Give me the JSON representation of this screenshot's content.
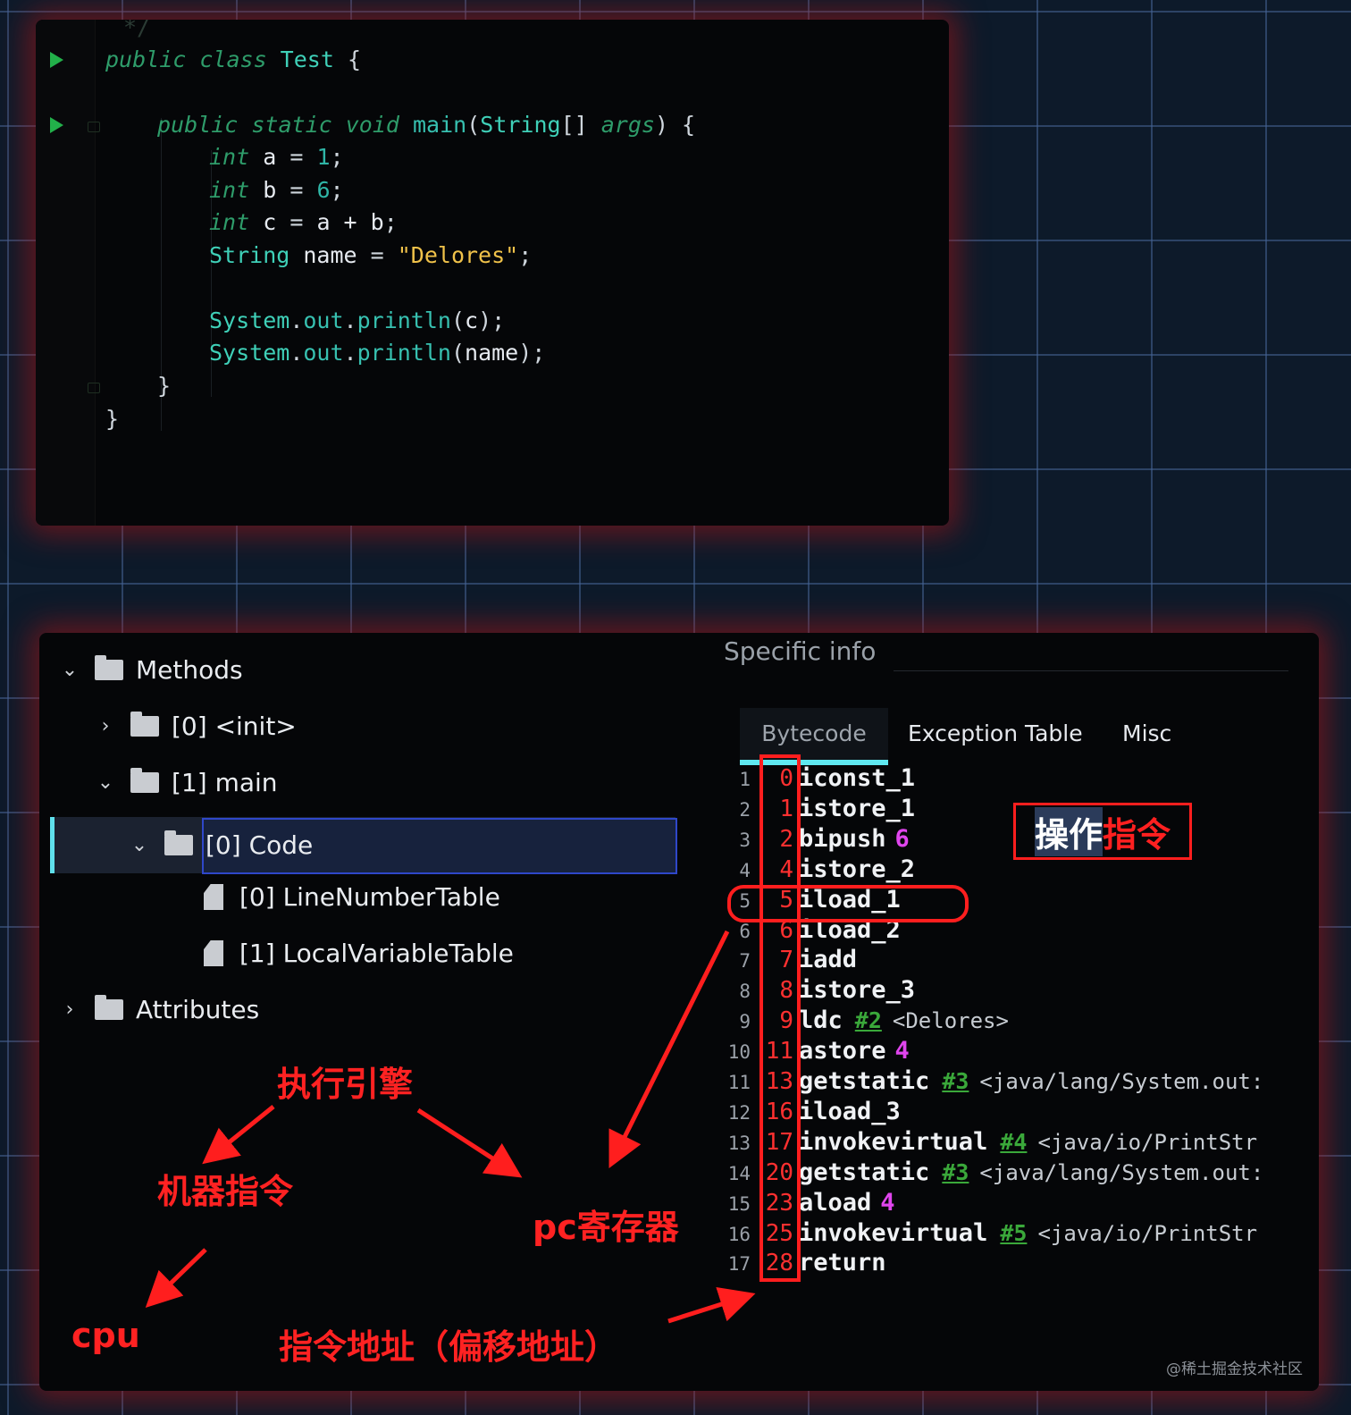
{
  "editor": {
    "lines": [
      {
        "t": "comment",
        "text": "*/"
      },
      {
        "t": "class",
        "kw": "public class ",
        "name": "Test",
        "rest": " {"
      },
      {
        "t": "main",
        "kw": "public static void ",
        "name": "main",
        "p1": "(",
        "type": "String",
        "arr": "[]",
        "args": " args",
        "rest": ") {"
      },
      {
        "t": "decl",
        "kw": "int ",
        "var": "a",
        "op": " = ",
        "val": "1",
        "end": ";"
      },
      {
        "t": "decl",
        "kw": "int ",
        "var": "b",
        "op": " = ",
        "val": "6",
        "end": ";"
      },
      {
        "t": "decl",
        "kw": "int ",
        "var": "c",
        "op": " = ",
        "val": "a + b",
        "end": ";"
      },
      {
        "t": "strdecl",
        "type": "String ",
        "var": "name",
        "op": " = ",
        "val": "\"Delores\"",
        "end": ";"
      },
      {
        "t": "print",
        "sys": "System",
        "dot1": ".",
        "out": "out",
        "dot2": ".",
        "m": "println",
        "p1": "(",
        "arg": "c",
        "p2": ");"
      },
      {
        "t": "print",
        "sys": "System",
        "dot1": ".",
        "out": "out",
        "dot2": ".",
        "m": "println",
        "p1": "(",
        "arg": "name",
        "p2": ");"
      },
      {
        "t": "brace",
        "text": "}"
      },
      {
        "t": "brace",
        "text": "}"
      }
    ]
  },
  "tree": {
    "methods": "Methods",
    "init": "[0] <init>",
    "main": "[1] main",
    "code": "[0] Code",
    "line_number_table": "[0] LineNumberTable",
    "local_variable_table": "[1] LocalVariableTable",
    "attributes": "Attributes"
  },
  "specific_info": {
    "title": "Specific info",
    "tabs": [
      "Bytecode",
      "Exception Table",
      "Misc"
    ]
  },
  "bytecode": [
    {
      "ln": "1",
      "off": "0",
      "op": "iconst_1"
    },
    {
      "ln": "2",
      "off": "1",
      "op": "istore_1"
    },
    {
      "ln": "3",
      "off": "2",
      "op": "bipush",
      "arg": "6"
    },
    {
      "ln": "4",
      "off": "4",
      "op": "istore_2"
    },
    {
      "ln": "5",
      "off": "5",
      "op": "iload_1"
    },
    {
      "ln": "6",
      "off": "6",
      "op": "iload_2"
    },
    {
      "ln": "7",
      "off": "7",
      "op": "iadd"
    },
    {
      "ln": "8",
      "off": "8",
      "op": "istore_3"
    },
    {
      "ln": "9",
      "off": "9",
      "op": "ldc",
      "ref": "#2",
      "com": "<Delores>"
    },
    {
      "ln": "10",
      "off": "11",
      "op": "astore",
      "arg": "4"
    },
    {
      "ln": "11",
      "off": "13",
      "op": "getstatic",
      "ref": "#3",
      "com": "<java/lang/System.out:"
    },
    {
      "ln": "12",
      "off": "16",
      "op": "iload_3"
    },
    {
      "ln": "13",
      "off": "17",
      "op": "invokevirtual",
      "ref": "#4",
      "com": "<java/io/PrintStr"
    },
    {
      "ln": "14",
      "off": "20",
      "op": "getstatic",
      "ref": "#3",
      "com": "<java/lang/System.out:"
    },
    {
      "ln": "15",
      "off": "23",
      "op": "aload",
      "arg": "4"
    },
    {
      "ln": "16",
      "off": "25",
      "op": "invokevirtual",
      "ref": "#5",
      "com": "<java/io/PrintStr"
    },
    {
      "ln": "17",
      "off": "28",
      "op": "return"
    }
  ],
  "annotations": {
    "op_box_highlight": "操作",
    "op_box_rest": "指令",
    "execution_engine": "执行引擎",
    "machine_instruction": "机器指令",
    "pc_register": "pc寄存器",
    "cpu": "cpu",
    "instruction_address": "指令地址（偏移地址）"
  },
  "watermark": "@稀土掘金技术社区",
  "colors": {
    "annotation": "#ff2222",
    "selection_border": "#2f47c9",
    "tab_underline": "#5fe8f0"
  }
}
